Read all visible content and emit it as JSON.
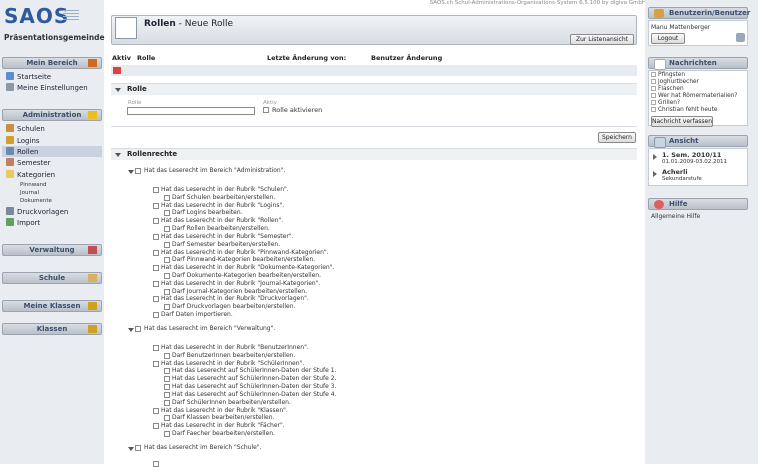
{
  "app": {
    "logo": "SAOS",
    "school": "Präsentationsgemeinde",
    "version": "SAOS.ch Schul-Administrations-Organisations-System 6.5.100 by digiva GmbH"
  },
  "sidebar": {
    "mein_bereich": {
      "title": "Mein Bereich",
      "items": [
        {
          "label": "Startseite"
        },
        {
          "label": "Meine Einstellungen"
        }
      ]
    },
    "administration": {
      "title": "Administration",
      "items": [
        {
          "label": "Schulen"
        },
        {
          "label": "Logins"
        },
        {
          "label": "Rollen"
        },
        {
          "label": "Semester"
        },
        {
          "label": "Kategorien"
        }
      ],
      "subitems": [
        "Pinnwand",
        "Journal",
        "Dokumente"
      ],
      "items2": [
        {
          "label": "Druckvorlagen"
        },
        {
          "label": "Import"
        }
      ]
    },
    "verwaltung": "Verwaltung",
    "schule": "Schule",
    "meine_klassen": "Meine Klassen",
    "klassen": "Klassen"
  },
  "main": {
    "title_bold": "Rollen",
    "title_rest": " - Neue Rolle",
    "back_button": "Zur Listenansicht",
    "columns": [
      "Aktiv",
      "Rolle",
      "Letzte Änderung von:",
      "Benutzer Änderung"
    ],
    "rolle_section": "Rolle",
    "rolle_label": "Rolle",
    "aktiv_label": "Aktiv",
    "rolle_aktivieren": "Rolle aktivieren",
    "save_button": "Speichern",
    "rollenrechte_section": "Rollenrechte",
    "groups": [
      {
        "label": "Hat das Leserecht im Bereich \"Administration\".",
        "perms": [
          {
            "t": "Hat das Leserecht in der Rubrik \"Schulen\".",
            "l": 1
          },
          {
            "t": "Darf Schulen bearbeiten/erstellen.",
            "l": 2
          },
          {
            "t": "Hat das Leserecht in der Rubrik \"Logins\".",
            "l": 1
          },
          {
            "t": "Darf Logins bearbeiten.",
            "l": 2
          },
          {
            "t": "Hat das Leserecht in der Rubrik \"Rollen\".",
            "l": 1
          },
          {
            "t": "Darf Rollen bearbeiten/erstellen.",
            "l": 2
          },
          {
            "t": "Hat das Leserecht in der Rubrik \"Semester\".",
            "l": 1
          },
          {
            "t": "Darf Semester bearbeiten/erstellen.",
            "l": 2
          },
          {
            "t": "Hat das Leserecht in der Rubrik \"Pinnwand-Kategorien\".",
            "l": 1
          },
          {
            "t": "Darf Pinnwand-Kategorien bearbeiten/erstellen.",
            "l": 2
          },
          {
            "t": "Hat das Leserecht in der Rubrik \"Dokumente-Kategorien\".",
            "l": 1
          },
          {
            "t": "Darf Dokumente-Kategorien bearbeiten/erstellen.",
            "l": 2
          },
          {
            "t": "Hat das Leserecht in der Rubrik \"Journal-Kategorien\".",
            "l": 1
          },
          {
            "t": "Darf Journal-Kategorien bearbeiten/erstellen.",
            "l": 2
          },
          {
            "t": "Hat das Leserecht in der Rubrik \"Druckvorlagen\".",
            "l": 1
          },
          {
            "t": "Darf Druckvorlagen bearbeiten/erstellen.",
            "l": 2
          },
          {
            "t": "Darf Daten importieren.",
            "l": 1
          }
        ]
      },
      {
        "label": "Hat das Leserecht im Bereich \"Verwaltung\".",
        "perms": [
          {
            "t": "Hat das Leserecht in der Rubrik \"BenutzerInnen\".",
            "l": 1
          },
          {
            "t": "Darf BenutzerInnen bearbeiten/erstellen.",
            "l": 2
          },
          {
            "t": "Hat das Leserecht in der Rubrik \"SchülerInnen\".",
            "l": 1
          },
          {
            "t": "Hat das Leserecht auf SchülerInnen-Daten der Stufe 1.",
            "l": 2
          },
          {
            "t": "Hat das Leserecht auf SchülerInnen-Daten der Stufe 2.",
            "l": 2
          },
          {
            "t": "Hat das Leserecht auf SchülerInnen-Daten der Stufe 3.",
            "l": 2
          },
          {
            "t": "Hat das Leserecht auf SchülerInnen-Daten der Stufe 4.",
            "l": 2
          },
          {
            "t": "Darf SchülerInnen bearbeiten/erstellen.",
            "l": 2
          },
          {
            "t": "Hat das Leserecht in der Rubrik \"Klassen\".",
            "l": 1
          },
          {
            "t": "Darf Klassen bearbeiten/erstellen.",
            "l": 2
          },
          {
            "t": "Hat das Leserecht in der Rubrik \"Fächer\".",
            "l": 1
          },
          {
            "t": "Darf Faecher bearbeiten/erstellen.",
            "l": 2
          }
        ]
      },
      {
        "label": "Hat das Leserecht im Bereich \"Schule\".",
        "perms": []
      }
    ]
  },
  "right": {
    "user_title": "Benutzerin/Benutzer",
    "user_name": "Manu Mattenberger",
    "logout": "Logout",
    "news_title": "Nachrichten",
    "messages": [
      "Pfingsten",
      "Joghurtbecher",
      "Flaschen",
      "Wer hat Römermaterialien?",
      "Grillen?",
      "Christian fehlt heute"
    ],
    "compose": "Nachricht verfassen",
    "view_title": "Ansicht",
    "semester": "1. Sem. 2010/11",
    "semester_dates": "01.01.2009-03.02.2011",
    "school_name": "Acherli",
    "school_level": "Sekundarstufe",
    "help_title": "Hilfe",
    "help_text": "Allgemeine Hilfe"
  },
  "colors": {
    "accent": "#2d5b9b",
    "panel": "#e9edf2",
    "header": "#b9c0c9"
  }
}
